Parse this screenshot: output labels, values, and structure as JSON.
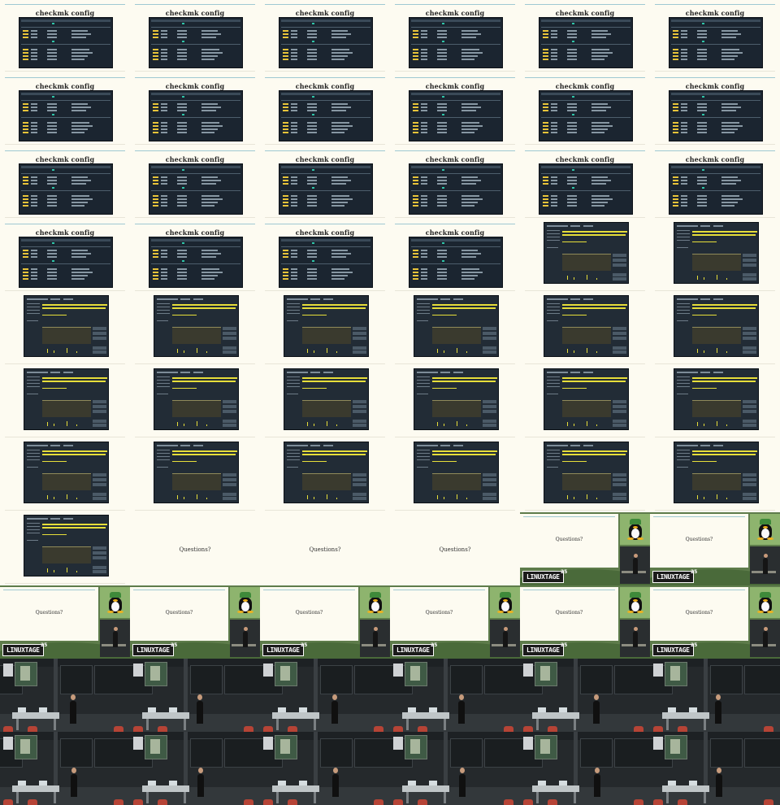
{
  "slides": {
    "checkmk_title": "checkmk config",
    "questions_text": "Questions?",
    "event_logo": "LINUXTAGE",
    "event_logo_sup": "25"
  },
  "colors": {
    "slide_background": "#fdfbf1",
    "accent_line": "#9fc9d2",
    "dashboard_dark": "#1b2530",
    "highlight_yellow": "#e6de3a",
    "frame_green": "#5e7c4b"
  },
  "grid": {
    "columns": 6,
    "rows": 11,
    "cells": [
      "checkmk",
      "checkmk",
      "checkmk",
      "checkmk",
      "checkmk",
      "checkmk",
      "checkmk",
      "checkmk",
      "checkmk",
      "checkmk",
      "checkmk",
      "checkmk",
      "checkmk",
      "checkmk",
      "checkmk",
      "checkmk",
      "checkmk",
      "checkmk",
      "checkmk",
      "checkmk",
      "checkmk",
      "checkmk",
      "graph",
      "graph",
      "graph",
      "graph",
      "graph",
      "graph",
      "graph",
      "graph",
      "graph",
      "graph",
      "graph",
      "graph",
      "graph",
      "graph",
      "graph",
      "graph",
      "graph",
      "graph",
      "graph",
      "graph",
      "graph",
      "questions",
      "questions",
      "questions",
      "overlay",
      "overlay",
      "overlay",
      "overlay",
      "overlay",
      "overlay",
      "overlay",
      "overlay",
      "room",
      "room",
      "room",
      "room",
      "room",
      "room",
      "room",
      "room",
      "room",
      "room",
      "room",
      "room"
    ]
  }
}
